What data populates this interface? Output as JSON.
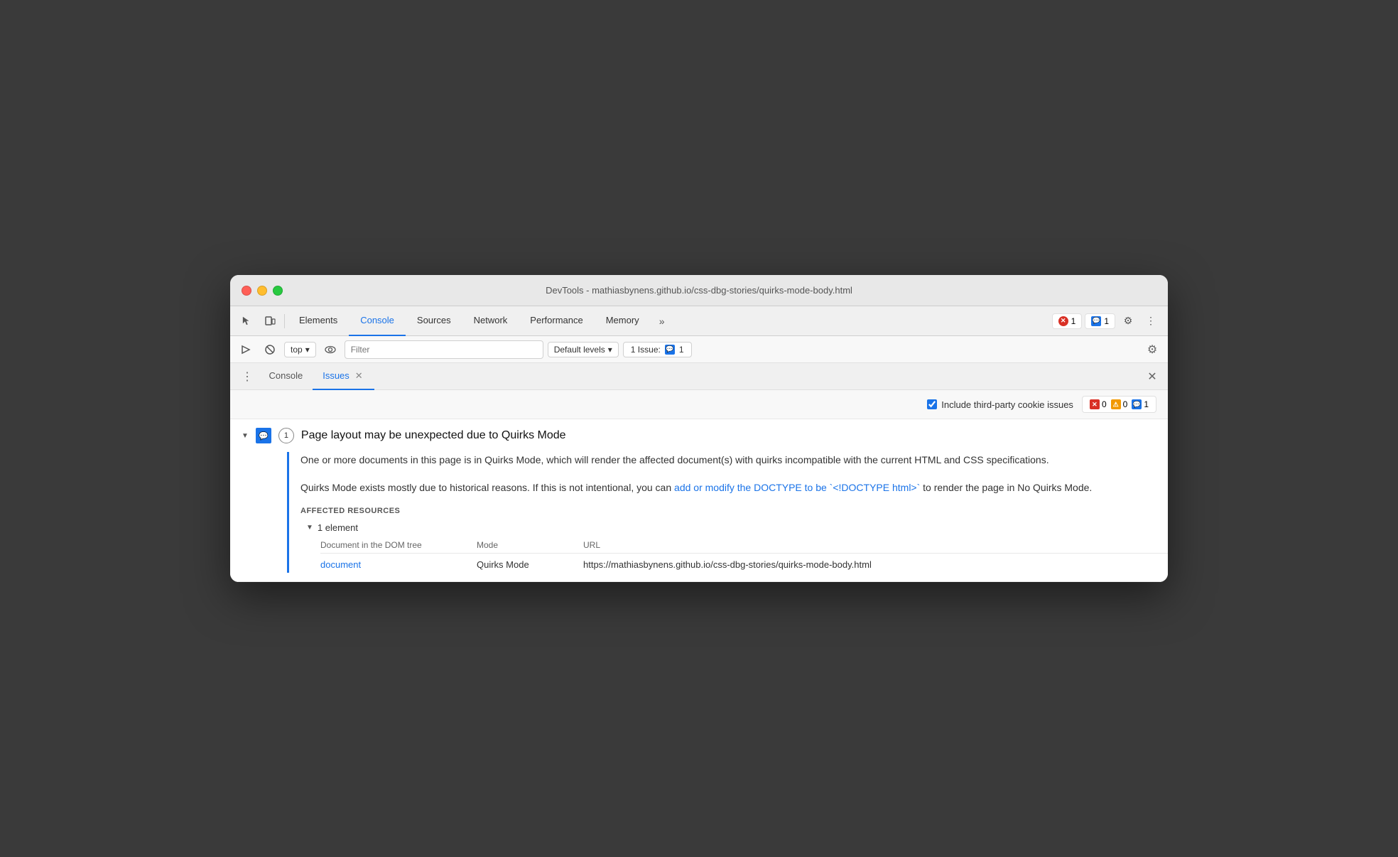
{
  "window": {
    "title": "DevTools - mathiasbynens.github.io/css-dbg-stories/quirks-mode-body.html"
  },
  "traffic_lights": {
    "close_label": "close",
    "minimize_label": "minimize",
    "maximize_label": "maximize"
  },
  "main_tabs": [
    {
      "id": "elements",
      "label": "Elements",
      "active": false
    },
    {
      "id": "console",
      "label": "Console",
      "active": true
    },
    {
      "id": "sources",
      "label": "Sources",
      "active": false
    },
    {
      "id": "network",
      "label": "Network",
      "active": false
    },
    {
      "id": "performance",
      "label": "Performance",
      "active": false
    },
    {
      "id": "memory",
      "label": "Memory",
      "active": false
    }
  ],
  "toolbar": {
    "more_label": "»",
    "error_count": "1",
    "message_count": "1",
    "settings_label": "⚙",
    "more_dots_label": "⋮"
  },
  "console_toolbar": {
    "clear_label": "🚫",
    "context_label": "top",
    "context_arrow": "▾",
    "eye_label": "👁",
    "filter_placeholder": "Filter",
    "levels_label": "Default levels",
    "levels_arrow": "▾",
    "issue_label": "1 Issue:",
    "settings_label": "⚙"
  },
  "panel": {
    "three_dot": "⋮",
    "tabs": [
      {
        "id": "console-tab",
        "label": "Console",
        "active": false,
        "closeable": false
      },
      {
        "id": "issues-tab",
        "label": "Issues",
        "active": true,
        "closeable": true
      }
    ],
    "close_label": "✕"
  },
  "issues_filter": {
    "checkbox_label": "Include third-party cookie issues",
    "checkbox_checked": true,
    "error_count": "0",
    "warning_count": "0",
    "info_count": "1"
  },
  "issue": {
    "title": "Page layout may be unexpected due to Quirks Mode",
    "count": "1",
    "description_1": "One or more documents in this page is in Quirks Mode, which will render the affected document(s) with quirks incompatible with the current HTML and CSS specifications.",
    "description_2_before": "Quirks Mode exists mostly due to historical reasons. If this is not intentional, you can ",
    "description_2_link": "add or modify the DOCTYPE to be `<!DOCTYPE html>`",
    "description_2_after": " to render the page in No Quirks Mode.",
    "affected_resources_label": "AFFECTED RESOURCES",
    "affected_element_label": "1 element",
    "col_document": "Document in the DOM tree",
    "col_mode": "Mode",
    "col_url": "URL",
    "row_mode": "Quirks Mode",
    "row_url": "https://mathiasbynens.github.io/css-dbg-stories/quirks-mode-body.html",
    "row_doc_link": "document"
  }
}
